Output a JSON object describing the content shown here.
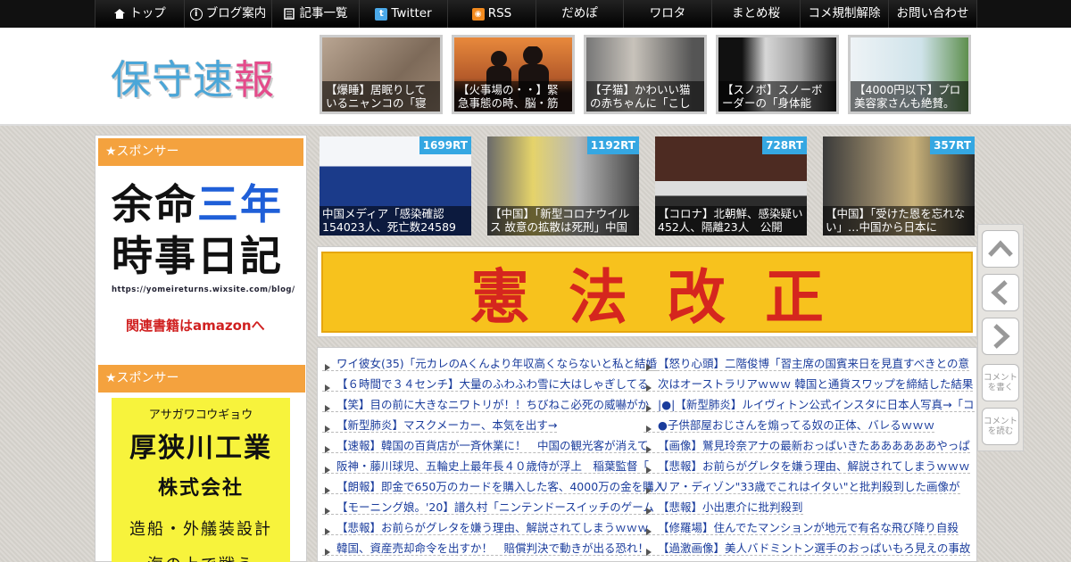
{
  "nav": {
    "items": [
      {
        "label": "トップ",
        "icon": "home-icon"
      },
      {
        "label": "ブログ案内",
        "icon": "info-icon"
      },
      {
        "label": "記事一覧",
        "icon": "list-icon"
      },
      {
        "label": "Twitter",
        "icon": "twitter-icon"
      },
      {
        "label": "RSS",
        "icon": "rss-icon"
      },
      {
        "label": "だめぽ"
      },
      {
        "label": "ワロタ"
      },
      {
        "label": "まとめ桜"
      },
      {
        "label": "コメ規制解除"
      },
      {
        "label": "お問い合わせ"
      }
    ]
  },
  "header": {
    "logo": {
      "c1": "保",
      "c2": "守",
      "c3": "速",
      "c4": "報"
    },
    "thumbs": [
      {
        "caption": "【爆睡】居眠りしているニャンコの「寝"
      },
      {
        "caption": "【火事場の・・】緊急事態の時、脳・筋"
      },
      {
        "caption": "【子猫】かわいい猫の赤ちゃんに「こし"
      },
      {
        "caption": "【スノボ】スノーボーダーの「身体能"
      },
      {
        "caption": "【4000円以下】プロ美容家さんも絶賛。"
      }
    ]
  },
  "sidebar": {
    "sponsor_title_1": "★スポンサー",
    "sponsor_title_2": "★スポンサー",
    "ad1": {
      "line1": "余命",
      "line1b": "三年",
      "line2": "時事日記",
      "url": "https://yomeireturns.wixsite.com/blog/",
      "link": "関連書籍はamazonへ"
    },
    "ad2": {
      "kana": "アサガワコウギョウ",
      "name": "厚狭川工業",
      "kaisha": "株式会社",
      "desc": "造船・外艤装設計",
      "more": "海の上で戦う"
    }
  },
  "rt_thumbs": [
    {
      "rt": "1699RT",
      "caption": "中国メディア「感染確認154023人、死亡数24589"
    },
    {
      "rt": "1192RT",
      "caption": "【中国】「新型コロナウイルス 故意の拡散は死刑」中国"
    },
    {
      "rt": "728RT",
      "caption": "【コロナ】北朝鮮、感染疑い452人、隔離23人　公開"
    },
    {
      "rt": "357RT",
      "caption": "【中国】「受けた恩を忘れない」…中国から日本に"
    }
  ],
  "banner": {
    "text": "憲法改正"
  },
  "articles": {
    "left": [
      "ワイ彼女(35)「元カレのAくんより年収高くならないと私と結婚",
      "【６時間で３４センチ】大量のふわふわ雪に大はしゃぎしてる",
      "【笑】目の前に大きなニワトリが！！ちびねこ必死の威嚇がか",
      "【新型肺炎】マスクメーカー、本気を出す→",
      "【速報】韓国の百貨店が一斉休業に！　中国の観光客が消えて",
      "阪神・藤川球児、五輪史上最年長４０歳侍が浮上　稲葉監督「",
      "【朗報】即金で650万のカードを購入した客、4000万の金を購入",
      "【モーニング娘。'20】譜久村「ニンテンドースイッチのゲーム",
      "【悲報】お前らがグレタを嫌う理由、解説されてしまうｗｗｗ",
      "韓国、資産売却命令を出すか！　賠償判決で動きが出る恐れ！"
    ],
    "right": [
      "【怒り心頭】二階俊博「習主席の国賓来日を見直すべきとの意",
      "次はオーストラリアｗｗｗ 韓国と通貨スワップを締結した結果",
      "|●|【新型肺炎】ルイヴィトン公式インスタに日本人写真→「コ",
      "●子供部屋おじさんを煽ってる奴の正体、バレるｗｗｗ",
      "【画像】鷲見玲奈アナの最新おっぱいきたああああああやっぱ",
      "【悲報】お前らがグレタを嫌う理由、解説されてしまうｗｗｗ",
      "リア・ディゾン\"33歳でこれはイタい\"と批判殺到した画像が",
      "【悲報】小出恵介に批判殺到",
      "【修羅場】住んでたマンションが地元で有名な飛び降り自殺",
      "【過激画像】美人バドミントン選手のおっぱいもろ見えの事故"
    ]
  },
  "floatbar": {
    "write_comment": "コメントを書く",
    "read_comment": "コメントを読む"
  }
}
